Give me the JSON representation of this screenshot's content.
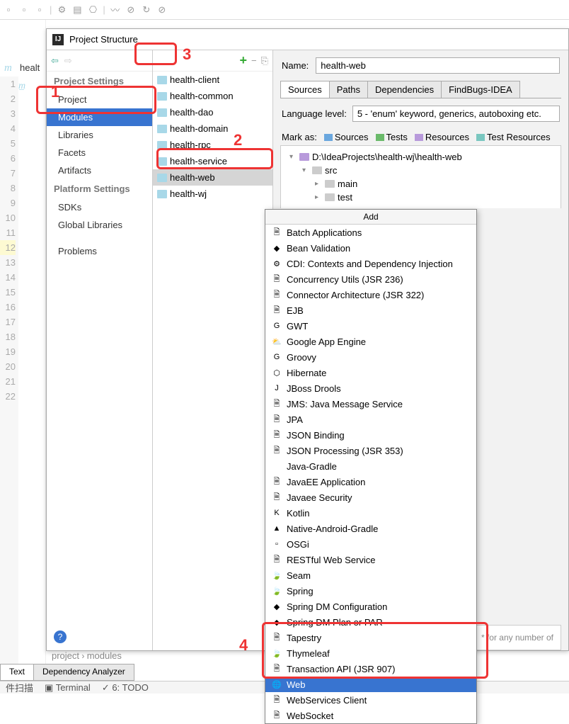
{
  "dialog": {
    "title": "Project Structure"
  },
  "sidebar": {
    "sections": [
      {
        "title": "Project Settings",
        "items": [
          "Project",
          "Modules",
          "Libraries",
          "Facets",
          "Artifacts"
        ]
      },
      {
        "title": "Platform Settings",
        "items": [
          "SDKs",
          "Global Libraries"
        ]
      },
      {
        "title": "",
        "items": [
          "Problems"
        ]
      }
    ],
    "selected": "Modules"
  },
  "modules": {
    "items": [
      "health-client",
      "health-common",
      "health-dao",
      "health-domain",
      "health-rpc",
      "health-service",
      "health-web",
      "health-wj"
    ],
    "selected": "health-web"
  },
  "name_label": "Name:",
  "name_value": "health-web",
  "tabs": {
    "items": [
      "Sources",
      "Paths",
      "Dependencies",
      "FindBugs-IDEA"
    ],
    "active": "Sources"
  },
  "lang": {
    "label": "Language level:",
    "value": "5 - 'enum' keyword, generics, autoboxing etc."
  },
  "mark": {
    "label": "Mark as:",
    "sources": "Sources",
    "tests": "Tests",
    "resources": "Resources",
    "testres": "Test Resources"
  },
  "tree": {
    "root": "D:\\IdeaProjects\\health-wj\\health-web",
    "src": "src",
    "main": "main",
    "test": "test"
  },
  "wildcard": "* for any number of",
  "popup": {
    "title": "Add",
    "items": [
      "Batch Applications",
      "Bean Validation",
      "CDI: Contexts and Dependency Injection",
      "Concurrency Utils (JSR 236)",
      "Connector Architecture (JSR 322)",
      "EJB",
      "GWT",
      "Google App Engine",
      "Groovy",
      "Hibernate",
      "JBoss Drools",
      "JMS: Java Message Service",
      "JPA",
      "JSON Binding",
      "JSON Processing (JSR 353)",
      "Java-Gradle",
      "JavaEE Application",
      "Javaee Security",
      "Kotlin",
      "Native-Android-Gradle",
      "OSGi",
      "RESTful Web Service",
      "Seam",
      "Spring",
      "Spring DM Configuration",
      "Spring DM Plan or PAR",
      "Tapestry",
      "Thymeleaf",
      "Transaction API (JSR 907)",
      "Web",
      "WebServices Client",
      "WebSocket"
    ],
    "selected": "Web"
  },
  "breadcrumb": {
    "a": "project",
    "b": "modules"
  },
  "bottom_tabs": {
    "a": "Text",
    "b": "Dependency Analyzer"
  },
  "status": {
    "scan": "件扫描",
    "terminal": "Terminal",
    "todo": "6: TODO"
  },
  "tab_left": "healt",
  "annot": {
    "n1": "1",
    "n2": "2",
    "n3": "3",
    "n4": "4"
  },
  "gutter_lines": [
    "1",
    "2",
    "3",
    "4",
    "5",
    "6",
    "7",
    "8",
    "9",
    "10",
    "11",
    "12",
    "13",
    "14",
    "15",
    "16",
    "17",
    "18",
    "19",
    "20",
    "21",
    "22"
  ]
}
